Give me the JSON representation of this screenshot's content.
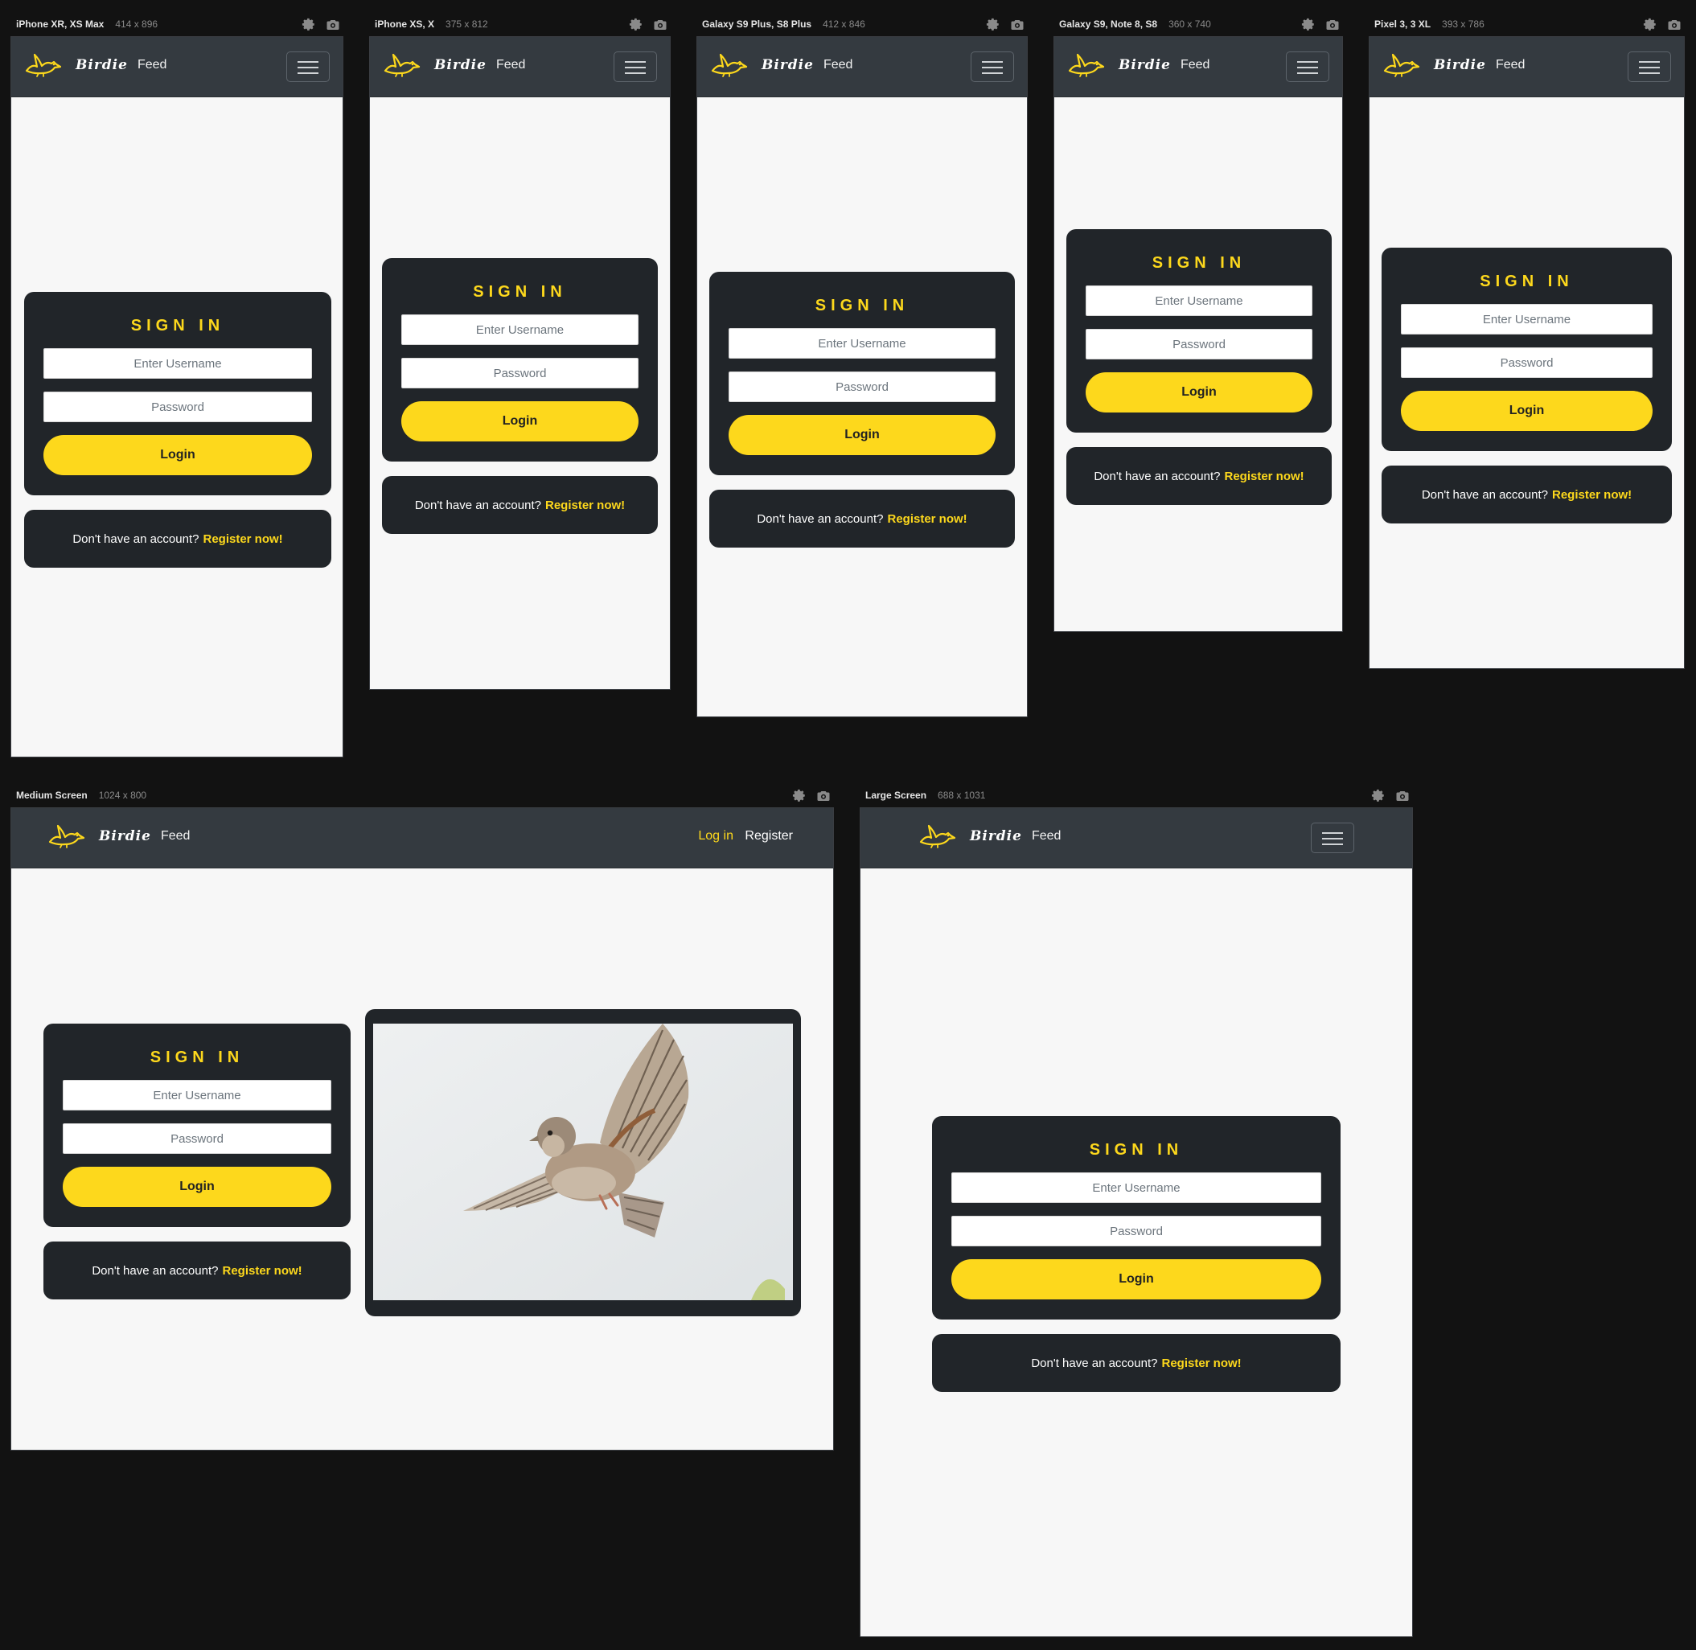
{
  "app": {
    "brand_name": "Birdie",
    "brand_feed": "Feed",
    "signin_title": "SIGN IN",
    "username_placeholder": "Enter Username",
    "password_placeholder": "Password",
    "login_button": "Login",
    "register_prompt": "Don't have an account?",
    "register_link": "Register now!",
    "nav_login": "Log in",
    "nav_register": "Register"
  },
  "devices": [
    {
      "name": "iPhone XR, XS Max",
      "dims": "414 x 896"
    },
    {
      "name": "iPhone XS, X",
      "dims": "375 x 812"
    },
    {
      "name": "Galaxy S9 Plus, S8 Plus",
      "dims": "412 x 846"
    },
    {
      "name": "Galaxy S9, Note 8, S8",
      "dims": "360 x 740"
    },
    {
      "name": "Pixel 3, 3 XL",
      "dims": "393 x 786"
    },
    {
      "name": "Medium Screen",
      "dims": "1024 x 800"
    },
    {
      "name": "Large Screen",
      "dims": "688 x 1031"
    }
  ],
  "colors": {
    "accent": "#fdd81c",
    "navbar": "#343a40",
    "card": "#212529",
    "page": "#f7f7f7",
    "workspace": "#121212"
  },
  "icons": {
    "settings": "gear-icon",
    "screenshot": "camera-icon",
    "logo": "bird-logo-icon",
    "menu": "hamburger-menu-icon"
  }
}
